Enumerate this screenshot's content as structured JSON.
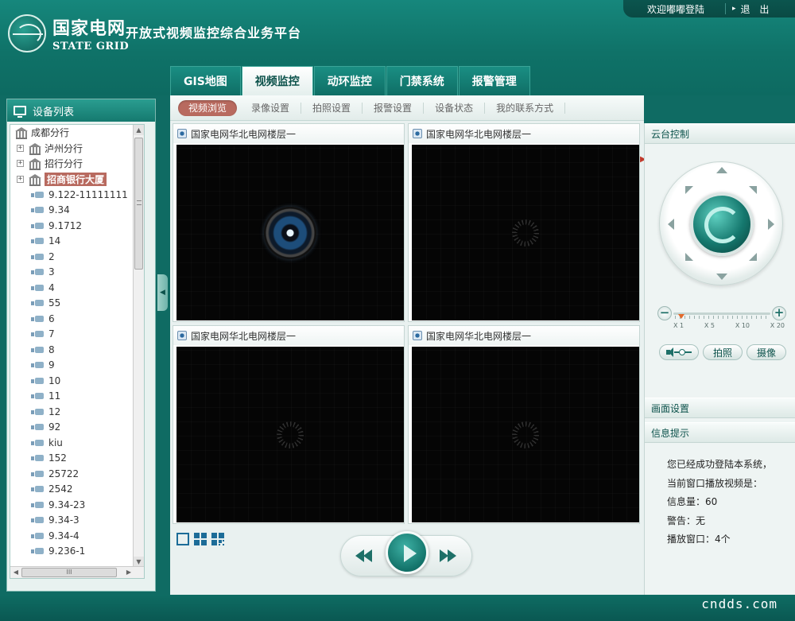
{
  "header": {
    "logo_cn": "国家电网",
    "logo_en": "STATE GRID",
    "platform_title": "开放式视频监控综合业务平台",
    "welcome": "欢迎嘟嘟登陆",
    "logout": "退 出"
  },
  "main_tabs": [
    {
      "label": "GIS地图",
      "active": false
    },
    {
      "label": "视频监控",
      "active": true
    },
    {
      "label": "动环监控",
      "active": false
    },
    {
      "label": "门禁系统",
      "active": false
    },
    {
      "label": "报警管理",
      "active": false
    }
  ],
  "sidebar": {
    "title": "设备列表",
    "tree": {
      "root": "成都分行",
      "branches": [
        "泸州分行",
        "招行分行",
        "招商银行大厦"
      ],
      "expander_symbol": "+",
      "devices": [
        "9.122-11111111",
        "9.34",
        "9.1712",
        "14",
        "2",
        "3",
        "4",
        "55",
        "6",
        "7",
        "8",
        "9",
        "10",
        "11",
        "12",
        "92",
        "kiu",
        "152",
        "25722",
        "2542",
        "9.34-23",
        "9.34-3",
        "9.34-4",
        "9.236-1"
      ]
    },
    "scroll_grip": "III"
  },
  "sub_tabs": [
    {
      "label": "视频浏览",
      "active": true
    },
    {
      "label": "录像设置",
      "active": false
    },
    {
      "label": "拍照设置",
      "active": false
    },
    {
      "label": "报警设置",
      "active": false
    },
    {
      "label": "设备状态",
      "active": false
    },
    {
      "label": "我的联系方式",
      "active": false
    }
  ],
  "video_panels": [
    {
      "title": "国家电网华北电网楼层一",
      "state": "lens"
    },
    {
      "title": "国家电网华北电网楼层一",
      "state": "loading"
    },
    {
      "title": "国家电网华北电网楼层一",
      "state": "loading"
    },
    {
      "title": "国家电网华北电网楼层一",
      "state": "loading"
    }
  ],
  "right_panel": {
    "ptz_title": "云台控制",
    "zoom_labels": [
      "X 1",
      "X 5",
      "X 10",
      "X 20"
    ],
    "zoom_level": "X 1",
    "snapshot_label": "拍照",
    "record_label": "摄像",
    "screen_settings_title": "画面设置",
    "info_title": "信息提示",
    "info_lines": [
      "您已经成功登陆本系统，",
      "当前窗口播放视频是：",
      "信息量：60",
      "警告：无",
      "播放窗口：4个"
    ]
  },
  "footer": {
    "watermark": "cndds.com"
  },
  "colors": {
    "brand_teal": "#0f6b63",
    "active_pill": "#b86a5f",
    "accent_blue": "#1c6c98"
  }
}
